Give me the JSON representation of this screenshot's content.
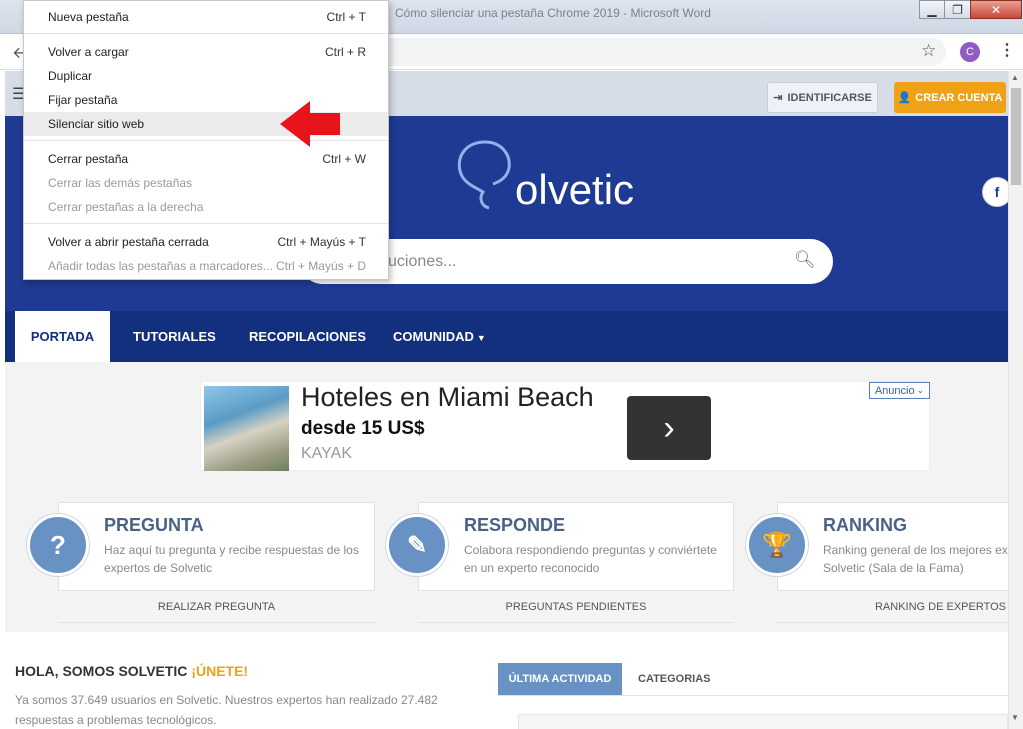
{
  "window": {
    "title": "Cómo silenciar una pestaña Chrome 2019 - Microsoft Word",
    "minimize": "▁",
    "maximize": "❐",
    "close": "✕"
  },
  "profile": {
    "initial": "C"
  },
  "menu": {
    "items": [
      {
        "label": "Nueva pestaña",
        "shortcut": "Ctrl + T"
      },
      {
        "label": "Volver a cargar",
        "shortcut": "Ctrl + R"
      },
      {
        "label": "Duplicar",
        "shortcut": ""
      },
      {
        "label": "Fijar pestaña",
        "shortcut": ""
      },
      {
        "label": "Silenciar sitio web",
        "shortcut": ""
      },
      {
        "label": "Cerrar pestaña",
        "shortcut": "Ctrl + W"
      },
      {
        "label": "Cerrar las demás pestañas",
        "shortcut": ""
      },
      {
        "label": "Cerrar pestañas a la derecha",
        "shortcut": ""
      },
      {
        "label": "Volver a abrir pestaña cerrada",
        "shortcut": "Ctrl + Mayús + T"
      },
      {
        "label": "Añadir todas las pestañas a marcadores...",
        "shortcut": "Ctrl + Mayús + D"
      }
    ]
  },
  "header": {
    "login_label": "IDENTIFICARSE",
    "signup_label": "CREAR CUENTA",
    "logo_text": "olvetic",
    "logo_letter": "S",
    "search_placeholder": "uciones...",
    "facebook": "f"
  },
  "nav": {
    "items": [
      "PORTADA",
      "TUTORIALES",
      "RECOPILACIONES",
      "COMUNIDAD"
    ]
  },
  "ad": {
    "badge": "Anuncio",
    "title": "Hoteles en Miami Beach",
    "subtitle": "desde 15 US$",
    "brand": "KAYAK"
  },
  "cards": [
    {
      "title": "PREGUNTA",
      "desc1": "Haz aquí tu pregunta y recibe respuestas de los",
      "desc2": "expertos de Solvetic",
      "button": "REALIZAR PREGUNTA",
      "icon": "?"
    },
    {
      "title": "RESPONDE",
      "desc1": "Colabora respondiendo preguntas y conviértete",
      "desc2": "en un experto reconocido",
      "button": "PREGUNTAS PENDIENTES",
      "icon": "✎"
    },
    {
      "title": "RANKING",
      "desc1": "Ranking general de los mejores ex",
      "desc2": "Solvetic (Sala de la Fama)",
      "button": "RANKING DE EXPERTOS",
      "icon": "🏆"
    }
  ],
  "welcome": {
    "heading": "HOLA, SOMOS SOLVETIC",
    "join": "¡ÚNETE!",
    "line1": "Ya somos 37.649 usuarios en Solvetic. Nuestros expertos han realizado 27.482",
    "line2": "respuestas a problemas tecnológicos."
  },
  "tabs": {
    "activity": "ÚLTIMA ACTIVIDAD",
    "categories": "CATEGORIAS"
  }
}
